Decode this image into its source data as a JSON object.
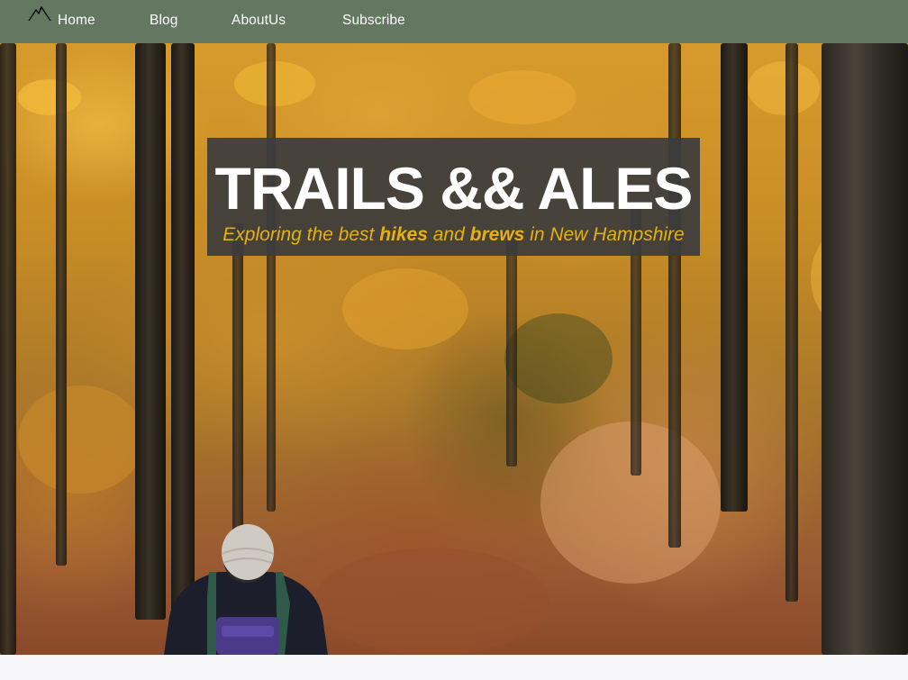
{
  "nav": {
    "logo_icon": "mountain-icon",
    "items": [
      {
        "label": "Home"
      },
      {
        "label": "Blog"
      },
      {
        "label": "AboutUs"
      },
      {
        "label": "Subscribe"
      }
    ],
    "background": "#637761"
  },
  "hero": {
    "title": "TRAILS && ALES",
    "tagline": {
      "part1": "Exploring the best ",
      "bold1": "hikes",
      "part2": " and ",
      "bold2": "brews",
      "part3": " in New Hampshire"
    },
    "title_box_color": "#3c3c3c",
    "tagline_color": "#e6b012",
    "image_description_icon": "autumn-forest-hiker-photo"
  }
}
